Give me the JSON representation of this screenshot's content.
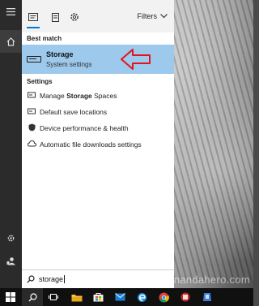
{
  "search_panel": {
    "filters_label": "Filters",
    "best_match_label": "Best match",
    "best_match": {
      "title_prefix": "Storage",
      "subtitle": "System settings"
    },
    "settings_label": "Settings",
    "settings_items": [
      {
        "before": "Manage ",
        "bold": "Storage",
        "after": " Spaces",
        "icon": "storage-spaces-icon"
      },
      {
        "before": "Default save locations",
        "bold": "",
        "after": "",
        "icon": "save-location-icon"
      },
      {
        "before": "Device performance & health",
        "bold": "",
        "after": "",
        "icon": "shield-icon"
      },
      {
        "before": "Automatic file downloads settings",
        "bold": "",
        "after": "",
        "icon": "cloud-icon"
      }
    ]
  },
  "search_box": {
    "value": "storage"
  },
  "watermark": "nandahero.com",
  "colors": {
    "highlight": "#9dc9ec",
    "accent": "#0078d7",
    "arrow": "#e0161c"
  }
}
